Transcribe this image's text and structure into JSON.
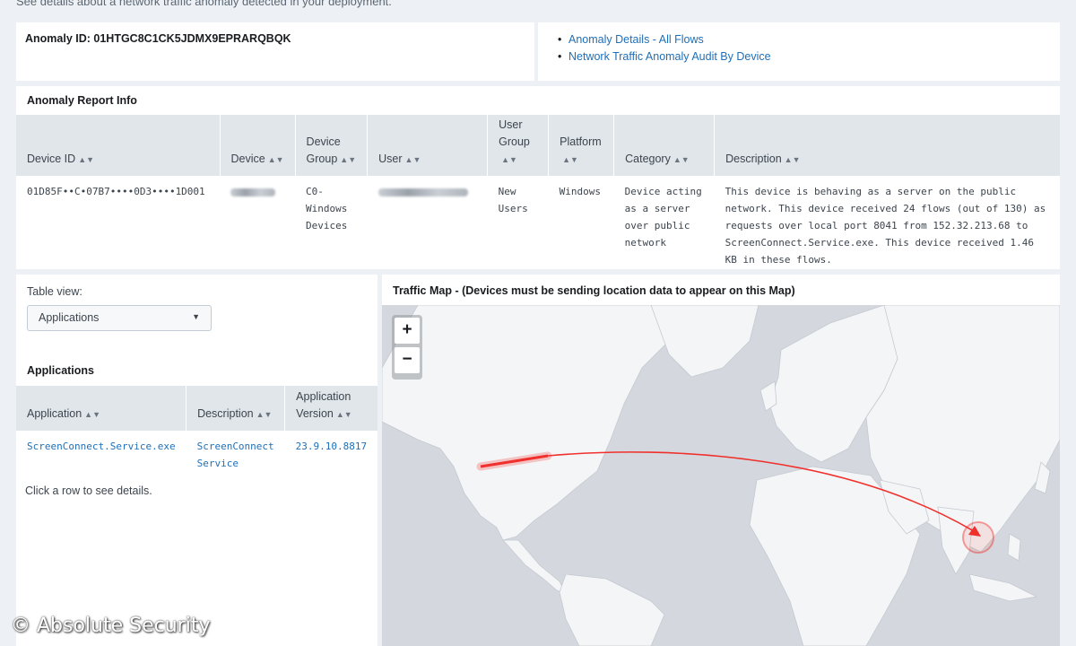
{
  "header": {
    "subtitle": "See details about a network traffic anomaly detected in your deployment."
  },
  "anomaly": {
    "id_label": "Anomaly ID: 01HTGC8C1CK5JDMX9EPRARQBQK"
  },
  "links": [
    {
      "label": "Anomaly Details - All Flows"
    },
    {
      "label": "Network Traffic Anomaly Audit By Device"
    }
  ],
  "report": {
    "title": "Anomaly Report Info",
    "columns": [
      "Device ID",
      "Device",
      "Device Group",
      "User",
      "User Group",
      "Platform",
      "Category",
      "Description"
    ],
    "row": {
      "device_id": "01D85F••C•07B7••••0D3••••1D001",
      "device_group": "C0-Windows Devices",
      "user_group": "New Users",
      "platform": "Windows",
      "category": "Device acting as a server over public network",
      "description": "This device is behaving as a server on the public network. This device received 24 flows (out of 130) as requests over local port 8041 from 152.32.213.68 to ScreenConnect.Service.exe. This device received 1.46 KB in these flows."
    }
  },
  "table_view": {
    "label": "Table view:",
    "selected": "Applications"
  },
  "applications": {
    "title": "Applications",
    "columns": [
      "Application",
      "Description",
      "Application Version"
    ],
    "rows": [
      {
        "application": "ScreenConnect.Service.exe",
        "description": "ScreenConnect Service",
        "version": "23.9.10.8817"
      }
    ],
    "hint": "Click a row to see details."
  },
  "map": {
    "title": "Traffic Map - (Devices must be sending location data to appear on this Map)",
    "zoom_in": "+",
    "zoom_out": "−",
    "colors": {
      "water": "#d4d8de",
      "land": "#f4f5f7",
      "flow": "#f0302c"
    }
  },
  "watermark": "© Absolute Security"
}
